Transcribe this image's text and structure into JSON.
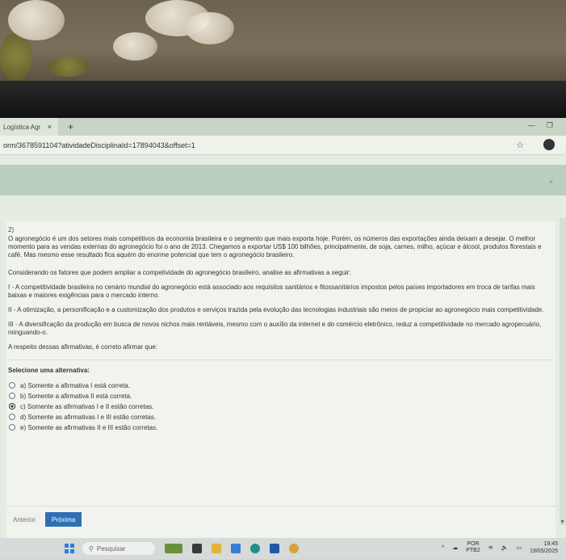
{
  "browser": {
    "tab_title": "Logística Agr",
    "tab_close": "×",
    "new_tab": "+",
    "url": "orm/3678591104?atividadeDisciplinaId=17894043&offset=1",
    "banner_close": "×"
  },
  "question": {
    "number": "2)",
    "intro": "O agronegócio é um dos setores mais competitivos da economia brasileira e o segmento que mais exporta hoje. Porém, os números das exportações ainda deixam a desejar. O melhor momento para as vendas externas do agronegócio foi o ano de 2013. Chegamos a exportar US$ 100 bilhões, principalmente, de soja, carnes, milho, açúcar e álcool, produtos florestais e café. Mas mesmo esse resultado fica aquém do enorme potencial que tem o agronegócio brasileiro.",
    "prompt": "Considerando os fatores que podem ampliar a competividade do agronegócio brasileiro, analise as afirmativas a seguir:",
    "statements": [
      "I - A competitividade brasileira no cenário mundial do agronegócio está associado aos requisitos sanitários e fitossanitários impostos pelos países importadores em troca de tarifas mais baixas e maiores exigências para o mercado interno.",
      "II - A otimização, a personificação e a customização dos produtos e serviços trazida pela evolução das tecnologias industriais são meios de propiciar ao agronegócio mais competitividade.",
      "III - A diversificação da produção em busca de novos nichos mais rentáveis, mesmo com o auxílio da internet e do comércio eletrônico, reduz a competitividade no mercado agropecuário, minguando-o."
    ],
    "ask": "A respeito dessas afirmativas, é correto afirmar que:",
    "select_title": "Selecione uma alternativa:",
    "options": [
      "a) Somente a afirmativa I está correta.",
      "b) Somente a afirmativa II está correta.",
      "c) Somente as afirmativas I e II estão corretas.",
      "d) Somente as afirmativas I e III estão corretas.",
      "e) Somente as afirmativas II e III estão corretas."
    ],
    "selected_index": 2,
    "prev_label": "Anterior",
    "next_label": "Próxima"
  },
  "taskbar": {
    "search_placeholder": "Pesquisar",
    "lang_top": "POR",
    "lang_bottom": "PTB2",
    "time": "19:45",
    "date": "19/05/2025"
  },
  "colors": {
    "next_button": "#2f6fb4",
    "page_bg": "#f1f4ee",
    "banner": "#bccfbf"
  }
}
